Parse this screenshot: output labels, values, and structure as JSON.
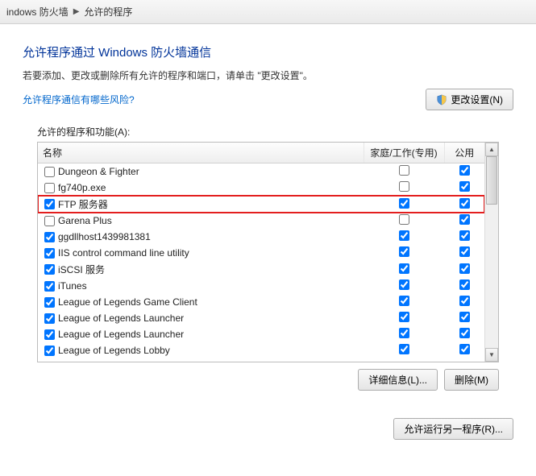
{
  "breadcrumb": {
    "part1": "indows 防火墙",
    "part2": "允许的程序"
  },
  "heading": "允许程序通过 Windows 防火墙通信",
  "subheading": "若要添加、更改或删除所有允许的程序和端口，请单击 \"更改设置\"。",
  "risk_link": "允许程序通信有哪些风险?",
  "change_settings_btn": "更改设置(N)",
  "panel_label": "允许的程序和功能(A):",
  "columns": {
    "name": "名称",
    "home": "家庭/工作(专用)",
    "public": "公用"
  },
  "rows": [
    {
      "enabled": false,
      "name": "Dungeon & Fighter",
      "home": false,
      "public": true,
      "highlight": false
    },
    {
      "enabled": false,
      "name": "fg740p.exe",
      "home": false,
      "public": true,
      "highlight": false
    },
    {
      "enabled": true,
      "name": "FTP 服务器",
      "home": true,
      "public": true,
      "highlight": true
    },
    {
      "enabled": false,
      "name": "Garena Plus",
      "home": false,
      "public": true,
      "highlight": false
    },
    {
      "enabled": true,
      "name": "ggdllhost1439981381",
      "home": true,
      "public": true,
      "highlight": false
    },
    {
      "enabled": true,
      "name": "IIS control command line utility",
      "home": true,
      "public": true,
      "highlight": false
    },
    {
      "enabled": true,
      "name": "iSCSI 服务",
      "home": true,
      "public": true,
      "highlight": false
    },
    {
      "enabled": true,
      "name": "iTunes",
      "home": true,
      "public": true,
      "highlight": false
    },
    {
      "enabled": true,
      "name": "League of Legends Game Client",
      "home": true,
      "public": true,
      "highlight": false
    },
    {
      "enabled": true,
      "name": "League of Legends Launcher",
      "home": true,
      "public": true,
      "highlight": false
    },
    {
      "enabled": true,
      "name": "League of Legends Launcher",
      "home": true,
      "public": true,
      "highlight": false
    },
    {
      "enabled": true,
      "name": "League of Legends Lobby",
      "home": true,
      "public": true,
      "highlight": false
    }
  ],
  "details_btn": "详细信息(L)...",
  "delete_btn": "删除(M)",
  "allow_another_btn": "允许运行另一程序(R)..."
}
